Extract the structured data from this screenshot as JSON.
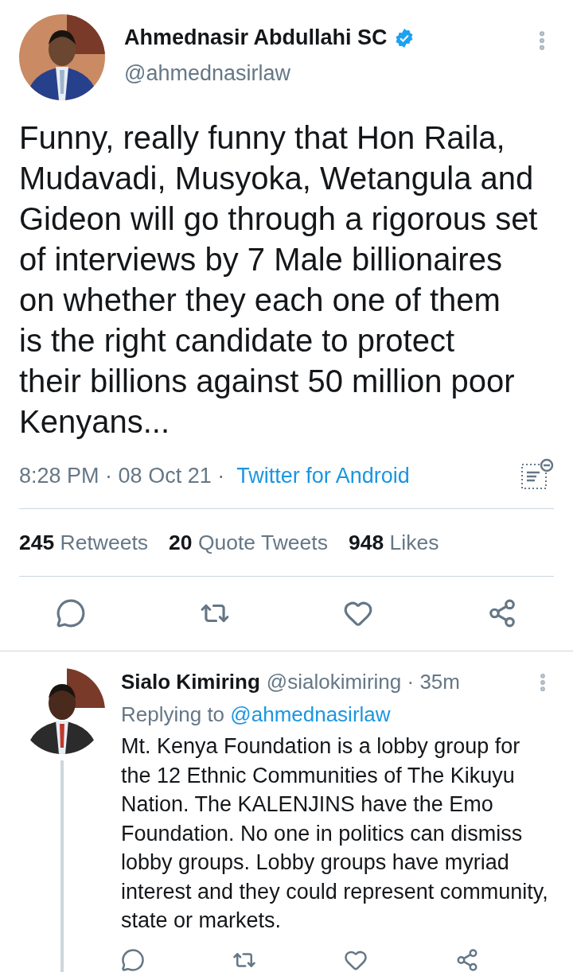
{
  "tweet": {
    "author": {
      "name": "Ahmednasir Abdullahi SC",
      "verified": true,
      "handle": "@ahmednasirlaw"
    },
    "body_lines": [
      "Funny, really funny that Hon Raila,",
      "Mudavadi, Musyoka, Wetangula and",
      "Gideon will go through a rigorous set",
      "of interviews by 7 Male billionaires",
      "on whether they each one of them",
      "is the right candidate to protect",
      "their billions against 50 million poor",
      "Kenyans..."
    ],
    "time": "8:28 PM",
    "separator": "·",
    "date": "08 Oct 21",
    "source": "Twitter for Android",
    "stats": [
      {
        "count": "245",
        "label": "Retweets"
      },
      {
        "count": "20",
        "label": "Quote Tweets"
      },
      {
        "count": "948",
        "label": "Likes"
      }
    ]
  },
  "reply": {
    "name": "Sialo Kimiring",
    "handle": "@sialokimiring",
    "separator": "·",
    "age": "35m",
    "replying_label": "Replying to",
    "replying_to": "@ahmednasirlaw",
    "body_lines": [
      "Mt. Kenya Foundation is a lobby group for",
      "the 12 Ethnic Communities of The Kikuyu",
      "Nation. The KALENJINS have the Emo",
      "Foundation. No one in politics can dismiss",
      "lobby groups. Lobby groups have myriad",
      "interest and they could represent community,",
      "state or markets."
    ]
  }
}
